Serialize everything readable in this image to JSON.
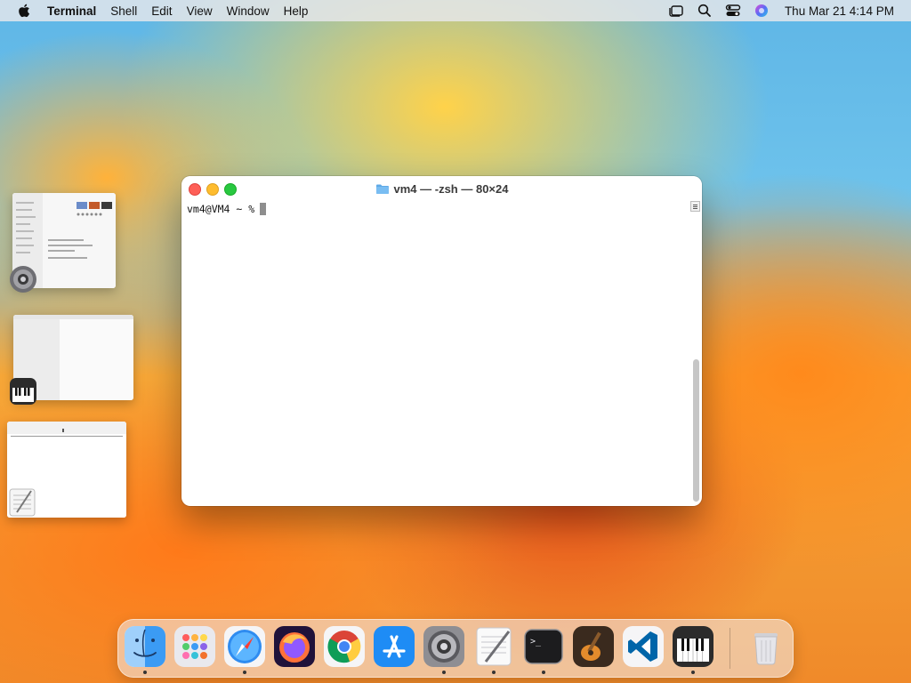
{
  "menubar": {
    "app_name": "Terminal",
    "items": [
      "Shell",
      "Edit",
      "View",
      "Window",
      "Help"
    ],
    "clock": "Thu Mar 21  4:14 PM"
  },
  "terminal": {
    "title": "vm4 — -zsh — 80×24",
    "prompt": "vm4@VM4 ~ %"
  },
  "stage_manager": {
    "groups": [
      "System Settings",
      "Piano app",
      "TextEdit"
    ]
  },
  "dock": {
    "apps": [
      "Finder",
      "Launchpad",
      "Safari",
      "Firefox",
      "Chrome",
      "App Store",
      "System Settings",
      "TextEdit",
      "Terminal",
      "GarageBand",
      "Visual Studio Code",
      "Piano"
    ],
    "running": [
      "Finder",
      "Safari",
      "System Settings",
      "TextEdit",
      "Terminal",
      "Piano"
    ],
    "trash": "Trash"
  },
  "colors": {
    "close": "#fe5f57",
    "minimize": "#febc2e",
    "maximize": "#28c840"
  }
}
